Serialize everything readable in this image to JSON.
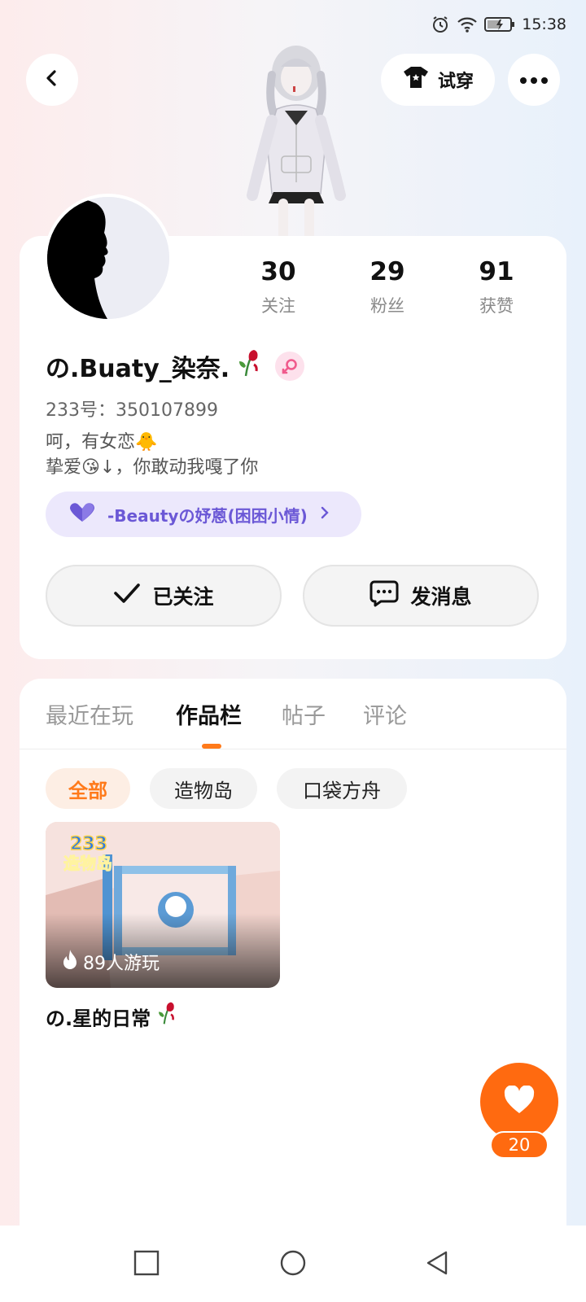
{
  "status_bar": {
    "time": "15:38"
  },
  "header": {
    "try_on_label": "试穿"
  },
  "stats": [
    {
      "value": "30",
      "label": "关注"
    },
    {
      "value": "29",
      "label": "粉丝"
    },
    {
      "value": "91",
      "label": "获赞"
    }
  ],
  "profile": {
    "username": "の.Buaty_染奈.",
    "id_line": "233号：350107899",
    "bio_line1": "呵，有女恋🐥",
    "bio_line2": "挚爱😘↓，你敢动我嘎了你",
    "couple_text": "-Beautyの妤蒽(困困小情)"
  },
  "actions": {
    "follow_label": "已关注",
    "message_label": "发消息"
  },
  "tabs": [
    "最近在玩",
    "作品栏",
    "帖子",
    "评论"
  ],
  "chips": [
    "全部",
    "造物岛",
    "口袋方舟"
  ],
  "work": {
    "logo_num": "233",
    "logo_text": "造物岛",
    "play_count": "89人游玩",
    "title": "の.星的日常"
  },
  "like": {
    "count": "20"
  },
  "colors": {
    "accent": "#ff6a10",
    "couple_purple": "#6b58d6"
  }
}
